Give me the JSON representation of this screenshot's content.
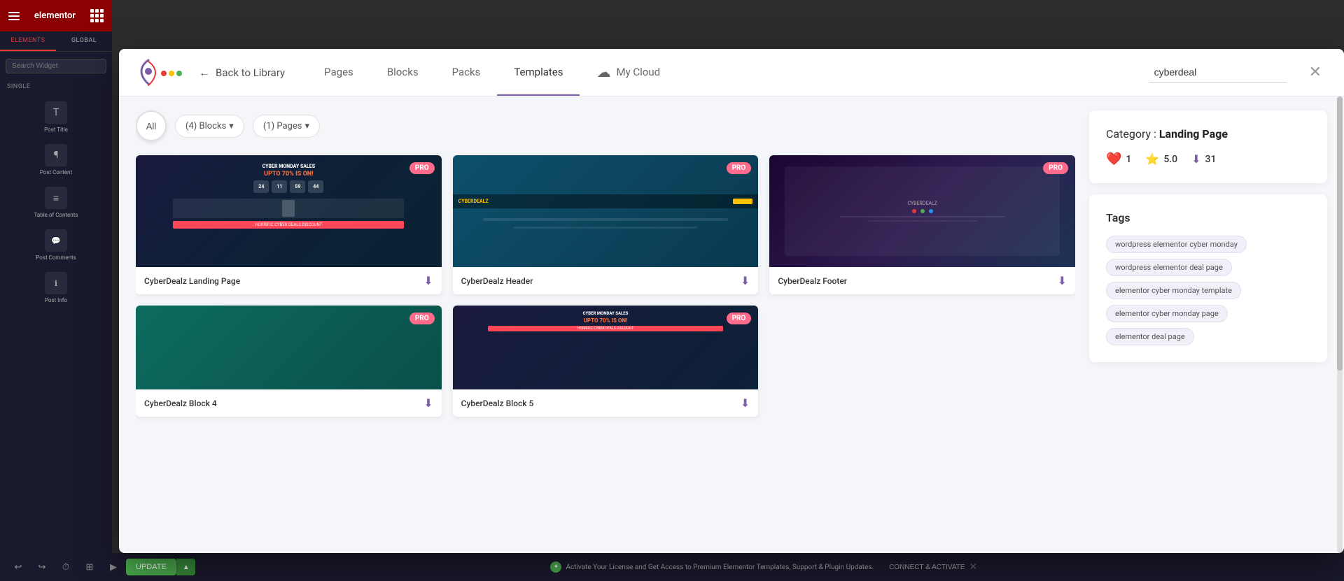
{
  "editor": {
    "logo_text": "elementor",
    "sidebar": {
      "tab_elements": "ELEMENTS",
      "tab_global": "GLOBAL",
      "search_placeholder": "Search Widget",
      "section_single": "SINGLE",
      "widgets": [
        {
          "label": "Post Title",
          "icon": "T"
        },
        {
          "label": "Post Content",
          "icon": "¶"
        },
        {
          "label": "Table of Contents",
          "icon": "≡"
        },
        {
          "label": "Post Comments",
          "icon": "💬"
        },
        {
          "label": "Post Info",
          "icon": "ℹ"
        }
      ]
    }
  },
  "bottom_bar": {
    "activate_message": "Activate Your License and Get Access to Premium Elementor Templates, Support & Plugin Updates.",
    "connect_label": "CONNECT & ACTIVATE",
    "update_label": "UPDATE"
  },
  "modal": {
    "back_label": "Back to Library",
    "nav_tabs": [
      {
        "label": "Pages",
        "active": false
      },
      {
        "label": "Blocks",
        "active": false
      },
      {
        "label": "Packs",
        "active": false
      },
      {
        "label": "Templates",
        "active": true
      },
      {
        "label": "My Cloud",
        "active": false,
        "has_icon": true
      }
    ],
    "search_value": "cyberdeal",
    "filters": {
      "all_label": "All",
      "blocks_label": "(4)  Blocks",
      "pages_label": "(1)  Pages"
    },
    "templates": [
      {
        "id": 1,
        "title": "CyberDealz Landing Page",
        "pro": true,
        "preview_type": "cyber-landing"
      },
      {
        "id": 2,
        "title": "CyberDealz Header",
        "pro": true,
        "preview_type": "cyber-header"
      },
      {
        "id": 3,
        "title": "CyberDealz Footer",
        "pro": true,
        "preview_type": "cyber-footer"
      },
      {
        "id": 4,
        "title": "CyberDealz Block 4",
        "pro": true,
        "preview_type": "cyber-block4"
      },
      {
        "id": 5,
        "title": "CyberDealz Block 5",
        "pro": true,
        "preview_type": "cyber-block5"
      }
    ],
    "sidebar": {
      "category_label": "Category : ",
      "category_value": "Landing Page",
      "stats": {
        "likes": "1",
        "rating": "5.0",
        "downloads": "31"
      },
      "tags_title": "Tags",
      "tags": [
        "wordpress elementor cyber monday",
        "wordpress elementor deal page",
        "elementor cyber monday template",
        "elementor cyber monday page",
        "elementor deal page"
      ]
    }
  },
  "countdown": {
    "hours": "24",
    "minutes": "11",
    "seconds": "59",
    "ms": "44"
  },
  "cyber_promo": {
    "line1": "CYBER MONDAY SALES",
    "line2": "UPTO 70% IS ON!",
    "percent_label": "UPTO 70% IS ON!"
  }
}
